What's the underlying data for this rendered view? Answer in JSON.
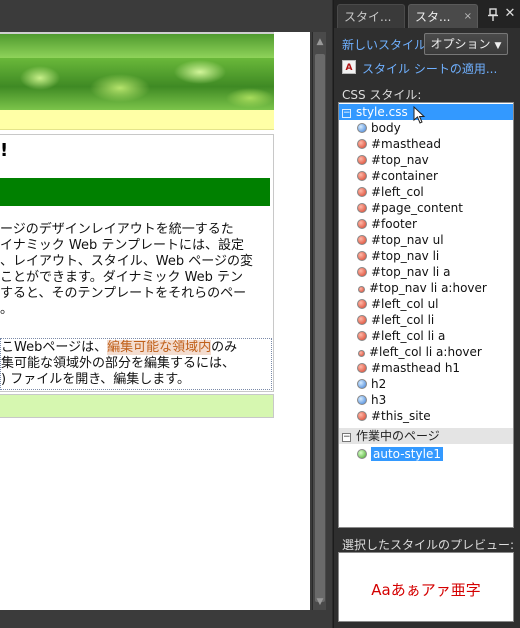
{
  "editor": {
    "heading": "!",
    "paragraph_lines": [
      "ージのデザインレイアウトを統一するた",
      "イナミック Web テンプレートには、設定",
      "、レイアウト、スタイル、Web ページの変",
      "ことができます。ダイナミック Web テン",
      "すると、そのテンプレートをそれらのペー",
      "。"
    ],
    "editable_line1_pre": "こWebページは、",
    "editable_line1_hl": "編集可能な領域内",
    "editable_line1_post": "のみ",
    "editable_line2": "集可能な領域外の部分を編集するには、",
    "editable_line3": ") ファイルを開き、編集します。"
  },
  "panel": {
    "tabs": [
      {
        "label": "スタイ..."
      },
      {
        "label": "スタ..."
      }
    ],
    "tab_close": "×",
    "new_style_link": "新しいスタイル...",
    "options_button": "オプション",
    "attach_link": "スタイル シートの適用...",
    "css_styles_label": "CSS スタイル:",
    "group_stylesheet": "style.css",
    "group_current_page": "作業中のページ",
    "styles": [
      {
        "name": "body",
        "dot": "blue"
      },
      {
        "name": "#masthead",
        "dot": "red"
      },
      {
        "name": "#top_nav",
        "dot": "red"
      },
      {
        "name": "#container",
        "dot": "red"
      },
      {
        "name": "#left_col",
        "dot": "red"
      },
      {
        "name": "#page_content",
        "dot": "red"
      },
      {
        "name": "#footer",
        "dot": "red"
      },
      {
        "name": "#top_nav ul",
        "dot": "red"
      },
      {
        "name": "#top_nav li",
        "dot": "red"
      },
      {
        "name": "#top_nav li a",
        "dot": "red"
      },
      {
        "name": "#top_nav li a:hover",
        "dot": "red-small"
      },
      {
        "name": "#left_col ul",
        "dot": "red"
      },
      {
        "name": "#left_col li",
        "dot": "red"
      },
      {
        "name": "#left_col li a",
        "dot": "red"
      },
      {
        "name": "#left_col li a:hover",
        "dot": "red-small"
      },
      {
        "name": "#masthead h1",
        "dot": "red"
      },
      {
        "name": "h2",
        "dot": "blue"
      },
      {
        "name": "h3",
        "dot": "blue"
      },
      {
        "name": "#this_site",
        "dot": "red"
      }
    ],
    "current_page_style": "auto-style1",
    "preview_label": "選択したスタイルのプレビュー:",
    "preview_text": "Aaあぁアァ亜字"
  },
  "colors": {
    "accent": "#3399ff",
    "link": "#6fb0ff",
    "preview_text": "#d40000",
    "nav_strip": "#ffffa6",
    "green_bar": "#008000",
    "footer_strip": "#d6f7b0"
  }
}
